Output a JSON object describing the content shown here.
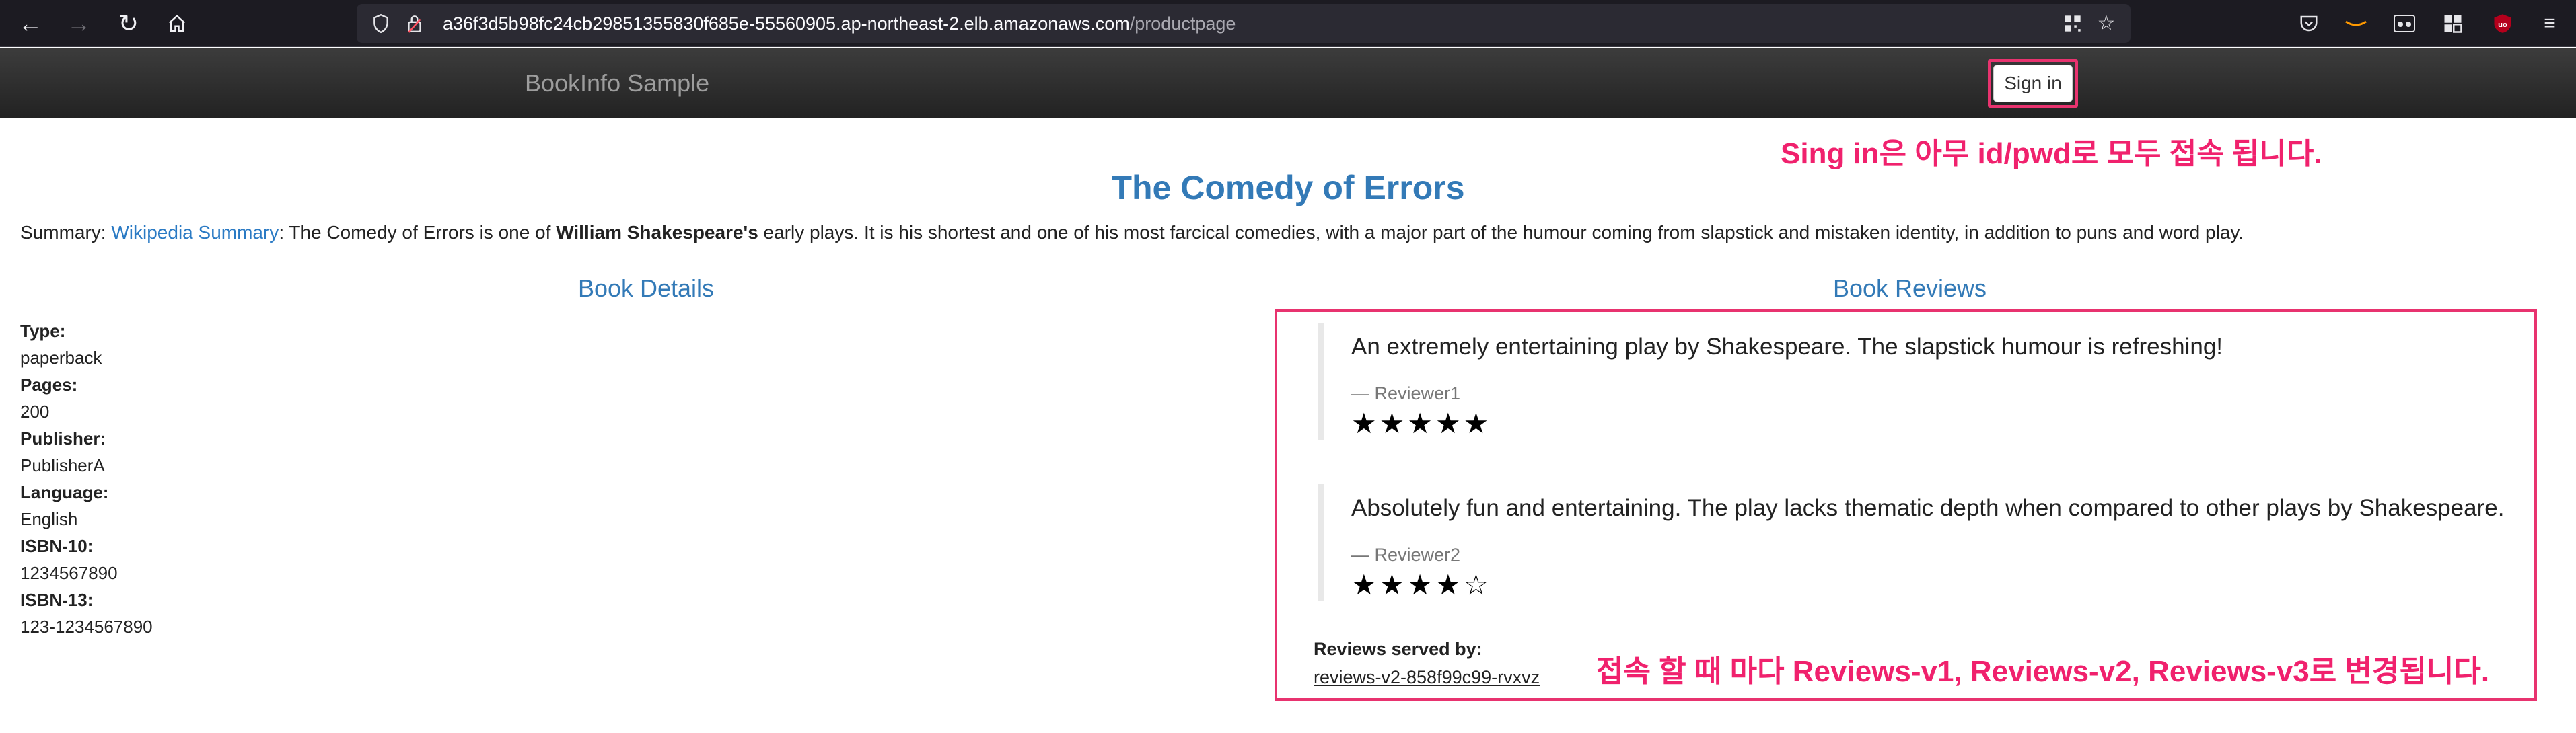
{
  "browser": {
    "url_host": "a36f3d5b98fc24cb29851355830f685e-55560905.ap-northeast-2.elb.amazonaws.com",
    "url_path": "/productpage",
    "icons": [
      "back-icon",
      "forward-icon",
      "reload-icon",
      "home-icon",
      "shield-icon",
      "lock-icon",
      "qr-icon",
      "bookmark-star-icon",
      "pocket-icon",
      "amazon-icon",
      "extension-icon",
      "grid-extension-icon",
      "ublock-icon",
      "menu-icon"
    ]
  },
  "navbar": {
    "brand": "BookInfo Sample",
    "signin_label": "Sign in"
  },
  "annotations": {
    "signin_note": "Sing in은 아무 id/pwd로 모두 접속 됩니다.",
    "reviews_note": "접속 할 때 마다 Reviews-v1, Reviews-v2, Reviews-v3로 변경됩니다.",
    "color": "#f0216d"
  },
  "book": {
    "title": "The Comedy of Errors",
    "summary_prefix": "Summary: ",
    "summary_link": "Wikipedia Summary",
    "summary_part1": ": The Comedy of Errors is one of ",
    "summary_bold": "William Shakespeare's",
    "summary_part2": " early plays. It is his shortest and one of his most farcical comedies, with a major part of the humour coming from slapstick and mistaken identity, in addition to puns and word play."
  },
  "details": {
    "heading": "Book Details",
    "type_label": "Type:",
    "type_value": "paperback",
    "pages_label": "Pages:",
    "pages_value": "200",
    "publisher_label": "Publisher:",
    "publisher_value": "PublisherA",
    "language_label": "Language:",
    "language_value": "English",
    "isbn10_label": "ISBN-10:",
    "isbn10_value": "1234567890",
    "isbn13_label": "ISBN-13:",
    "isbn13_value": "123-1234567890"
  },
  "reviews": {
    "heading": "Book Reviews",
    "items": [
      {
        "text": "An extremely entertaining play by Shakespeare. The slapstick humour is refreshing!",
        "reviewer": "— Reviewer1",
        "stars": "★★★★★",
        "rating": 5
      },
      {
        "text": "Absolutely fun and entertaining. The play lacks thematic depth when compared to other plays by Shakespeare.",
        "reviewer": "— Reviewer2",
        "stars": "★★★★☆",
        "rating": 4
      }
    ],
    "served_by_label": "Reviews served by:",
    "served_by_value": "reviews-v2-858f99c99-rvxvz"
  }
}
